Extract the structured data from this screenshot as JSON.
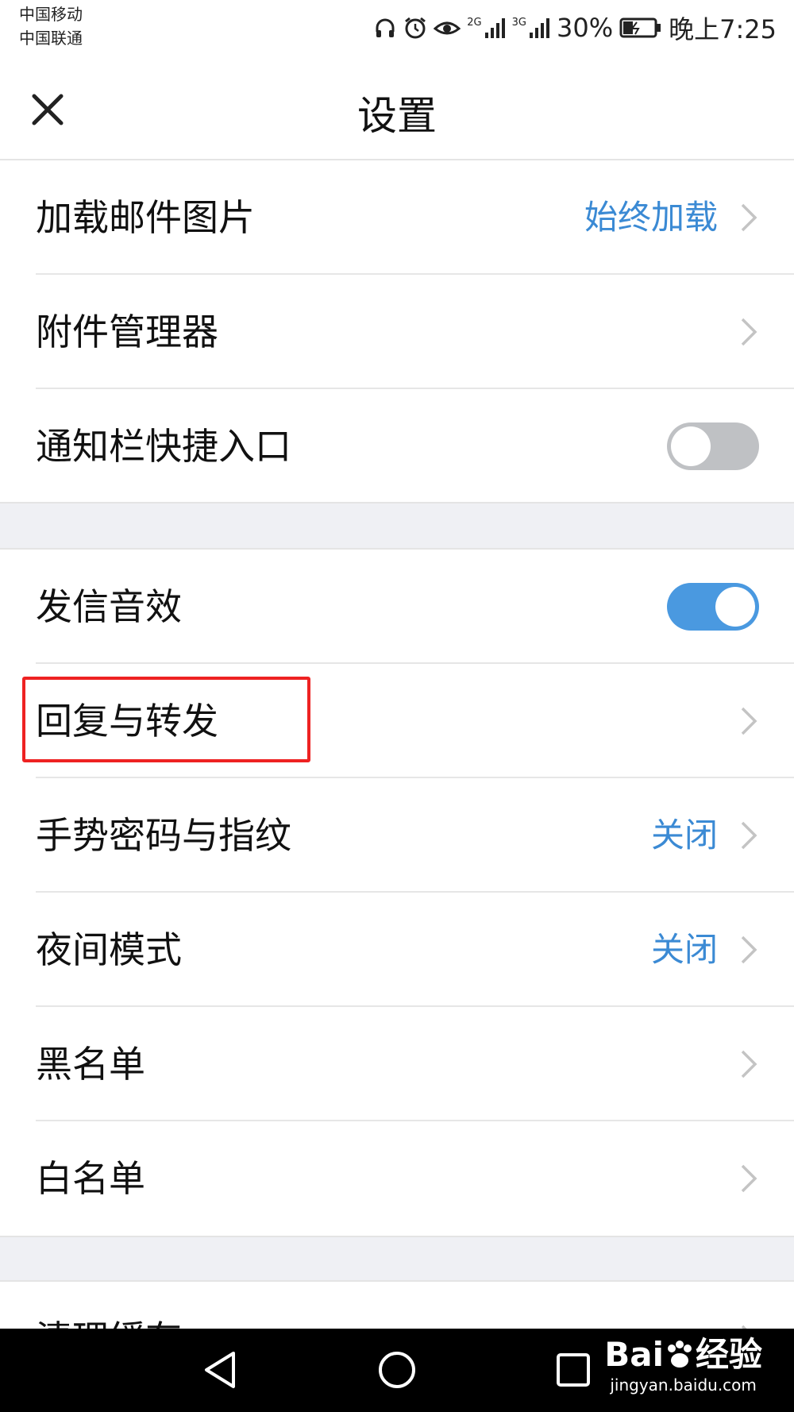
{
  "status_bar": {
    "carrier1": "中国移动",
    "carrier2": "中国联通",
    "net1": "2G",
    "net2": "3G",
    "battery": "30%",
    "time": "晚上7:25"
  },
  "header": {
    "title": "设置",
    "close_icon": "close-icon"
  },
  "settings": {
    "load_images": {
      "label": "加载邮件图片",
      "value": "始终加载"
    },
    "attachment_manager": {
      "label": "附件管理器"
    },
    "notification_shortcut": {
      "label": "通知栏快捷入口",
      "enabled": false
    },
    "send_sound": {
      "label": "发信音效",
      "enabled": true
    },
    "reply_forward": {
      "label": "回复与转发"
    },
    "gesture_password": {
      "label": "手势密码与指纹",
      "value": "关闭"
    },
    "night_mode": {
      "label": "夜间模式",
      "value": "关闭"
    },
    "blacklist": {
      "label": "黑名单"
    },
    "whitelist": {
      "label": "白名单"
    },
    "clear_cache": {
      "label": "清理缓存"
    }
  },
  "nav_bar": {
    "back_icon": "back-triangle-icon",
    "home_icon": "home-circle-icon",
    "recents_icon": "recents-square-icon"
  },
  "watermark": {
    "brand": "Bai",
    "brand2": "经验",
    "url": "jingyan.baidu.com"
  },
  "colors": {
    "accent": "#3b8ad4",
    "toggle_on": "#4a99e0",
    "toggle_off": "#bfc1c4",
    "highlight": "#ee2222",
    "section_gap": "#eff0f4"
  }
}
